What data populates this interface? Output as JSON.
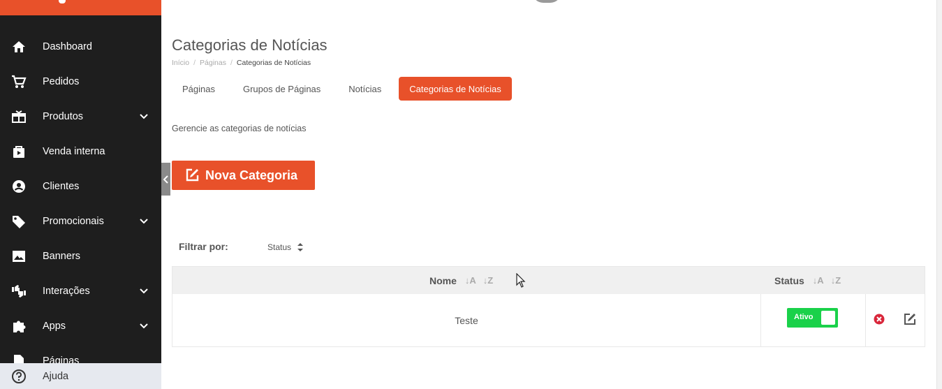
{
  "sidebar": {
    "items": [
      {
        "label": "Dashboard",
        "icon": "home-icon",
        "has_children": false
      },
      {
        "label": "Pedidos",
        "icon": "cart-icon",
        "has_children": false
      },
      {
        "label": "Produtos",
        "icon": "gift-box-icon",
        "has_children": true
      },
      {
        "label": "Venda interna",
        "icon": "shopping-bag-icon",
        "has_children": false
      },
      {
        "label": "Clientes",
        "icon": "user-circle-icon",
        "has_children": false
      },
      {
        "label": "Promocionais",
        "icon": "tag-icon",
        "has_children": true
      },
      {
        "label": "Banners",
        "icon": "image-icon",
        "has_children": false
      },
      {
        "label": "Interações",
        "icon": "thumbs-icon",
        "has_children": true
      },
      {
        "label": "Apps",
        "icon": "puzzle-icon",
        "has_children": true
      },
      {
        "label": "Páginas",
        "icon": "document-icon",
        "has_children": false
      }
    ],
    "help_label": "Ajuda"
  },
  "header": {
    "title": "Categorias de Notícias",
    "breadcrumb": [
      "Início",
      "Páginas",
      "Categorias de Notícias"
    ]
  },
  "tabs": [
    {
      "label": "Páginas",
      "active": false
    },
    {
      "label": "Grupos de Páginas",
      "active": false
    },
    {
      "label": "Notícias",
      "active": false
    },
    {
      "label": "Categorias de Notícias",
      "active": true
    }
  ],
  "description": "Gerencie as categorias de notícias",
  "new_button_label": "Nova Categoria",
  "filter": {
    "label": "Filtrar por:",
    "status_label": "Status"
  },
  "table": {
    "columns": [
      {
        "label": "Nome",
        "sort_asc": "A",
        "sort_desc": "Z"
      },
      {
        "label": "Status",
        "sort_asc": "A",
        "sort_desc": "Z"
      }
    ],
    "rows": [
      {
        "name": "Teste",
        "status": "Ativo"
      }
    ]
  },
  "colors": {
    "accent": "#e8512a",
    "sidebar_bg": "#1e1e1e",
    "active_status": "#1ad14a",
    "delete": "#d9263a"
  }
}
